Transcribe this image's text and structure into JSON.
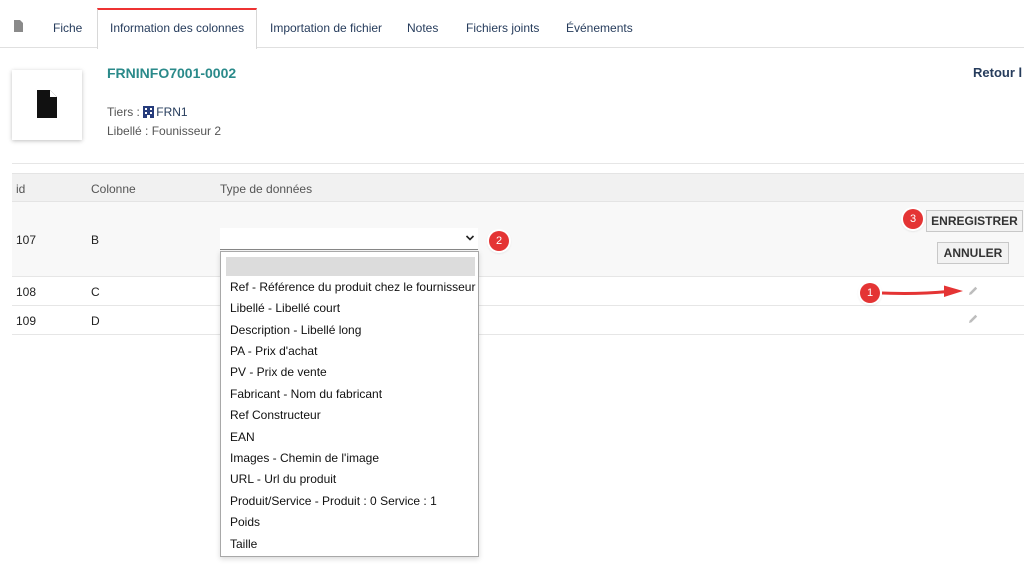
{
  "tabs": [
    {
      "label": "Fiche"
    },
    {
      "label": "Information des colonnes"
    },
    {
      "label": "Importation de fichier"
    },
    {
      "label": "Notes"
    },
    {
      "label": "Fichiers joints"
    },
    {
      "label": "Événements"
    }
  ],
  "record": {
    "ref": "FRNINFO7001-0002",
    "back_link": "Retour l",
    "tiers_label": "Tiers :",
    "tiers_value": "FRN1",
    "libelle": "Libellé : Founisseur 2"
  },
  "table": {
    "headers": [
      "id",
      "Colonne",
      "Type de données"
    ],
    "rows": [
      {
        "id": "107",
        "colonne": "B"
      },
      {
        "id": "108",
        "colonne": "C"
      },
      {
        "id": "109",
        "colonne": "D"
      }
    ]
  },
  "dropdown": {
    "selected": "",
    "options": [
      "Ref - Référence du produit chez le fournisseur",
      "Libellé - Libellé court",
      "Description - Libellé long",
      "PA - Prix d'achat",
      "PV - Prix de vente",
      "Fabricant - Nom du fabricant",
      "Ref Constructeur",
      "EAN",
      "Images - Chemin de l'image",
      "URL - Url du produit",
      "Produit/Service - Produit : 0 Service : 1",
      "Poids",
      "Taille"
    ]
  },
  "actions": {
    "save_label": "ENREGISTRER",
    "cancel_label": "ANNULER"
  },
  "annotations": {
    "badge_1": "1",
    "badge_2": "2",
    "badge_3": "3",
    "color": "#e43434"
  },
  "icons": {
    "tab_icon": "document-icon",
    "thumb_icon": "document-icon",
    "tiers_icon": "building-icon",
    "edit_icon": "pencil-icon"
  }
}
